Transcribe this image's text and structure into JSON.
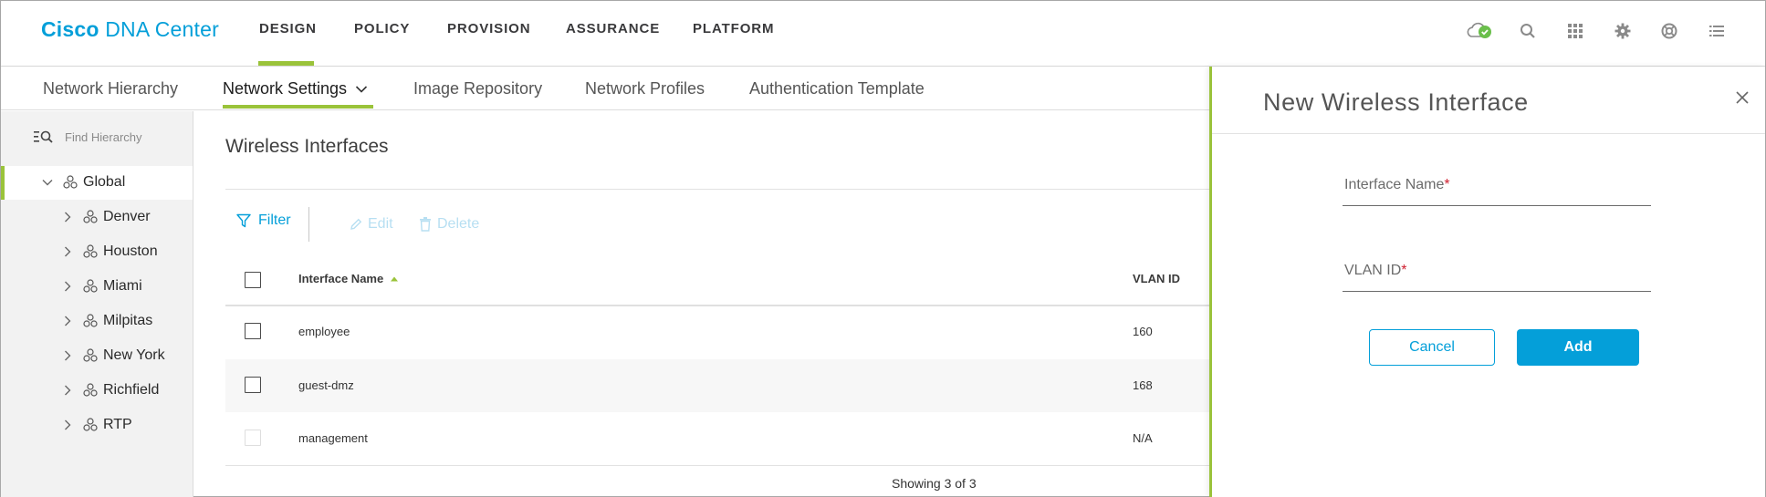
{
  "header": {
    "brand_bold": "Cisco",
    "brand_light": "DNA Center",
    "nav": [
      "DESIGN",
      "POLICY",
      "PROVISION",
      "ASSURANCE",
      "PLATFORM"
    ],
    "active_nav": "DESIGN",
    "icons": [
      "cloud-status-icon",
      "search-icon",
      "apps-grid-icon",
      "gear-icon",
      "help-icon",
      "menu-list-icon"
    ],
    "accent_color": "#9ac33a",
    "brand_color": "#049fd9"
  },
  "subnav": {
    "items": [
      "Network Hierarchy",
      "Network Settings",
      "Image Repository",
      "Network Profiles",
      "Authentication Template"
    ],
    "active": "Network Settings"
  },
  "sidebar": {
    "search_placeholder": "Find Hierarchy",
    "root": "Global",
    "sites": [
      "Denver",
      "Houston",
      "Miami",
      "Milpitas",
      "New York",
      "Richfield",
      "RTP"
    ]
  },
  "main": {
    "title": "Wireless Interfaces",
    "toolbar": {
      "filter": "Filter",
      "edit": "Edit",
      "delete": "Delete"
    },
    "table": {
      "columns": [
        "Interface Name",
        "VLAN ID"
      ],
      "rows": [
        {
          "name": "employee",
          "vlan": "160"
        },
        {
          "name": "guest-dmz",
          "vlan": "168"
        },
        {
          "name": "management",
          "vlan": "N/A"
        }
      ],
      "footer": "Showing 3 of 3"
    }
  },
  "panel": {
    "title": "New Wireless Interface",
    "fields": [
      {
        "label": "Interface Name",
        "required_mark": "*"
      },
      {
        "label": "VLAN ID",
        "required_mark": "*"
      }
    ],
    "cancel_label": "Cancel",
    "add_label": "Add"
  }
}
